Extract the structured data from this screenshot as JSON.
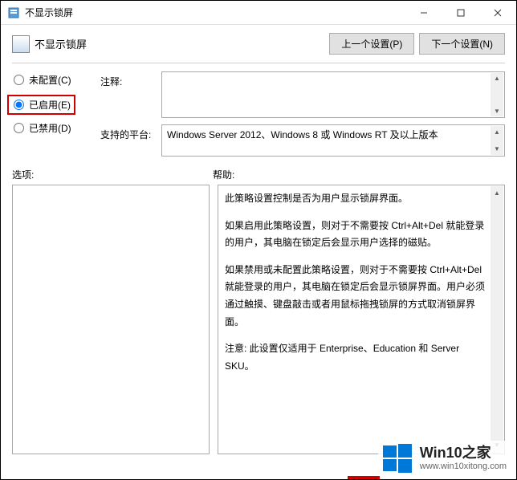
{
  "window": {
    "title": "不显示锁屏"
  },
  "header": {
    "policy_title": "不显示锁屏",
    "prev_button": "上一个设置(P)",
    "next_button": "下一个设置(N)"
  },
  "radios": {
    "not_configured": "未配置(C)",
    "enabled": "已启用(E)",
    "disabled": "已禁用(D)",
    "selected": "enabled"
  },
  "fields": {
    "comment_label": "注释:",
    "comment_value": "",
    "platform_label": "支持的平台:",
    "platform_value": "Windows Server 2012、Windows 8 或 Windows RT 及以上版本"
  },
  "sections": {
    "options_label": "选项:",
    "help_label": "帮助:"
  },
  "help_text": {
    "p1": "此策略设置控制是否为用户显示锁屏界面。",
    "p2": "如果启用此策略设置，则对于不需要按 Ctrl+Alt+Del 就能登录的用户，其电脑在锁定后会显示用户选择的磁贴。",
    "p3": "如果禁用或未配置此策略设置，则对于不需要按 Ctrl+Alt+Del 就能登录的用户，其电脑在锁定后会显示锁屏界面。用户必须通过触摸、键盘敲击或者用鼠标拖拽锁屏的方式取消锁屏界面。",
    "p4": "注意: 此设置仅适用于 Enterprise、Education 和 Server SKU。"
  },
  "watermark": {
    "title": "Win10之家",
    "url": "www.win10xitong.com"
  }
}
